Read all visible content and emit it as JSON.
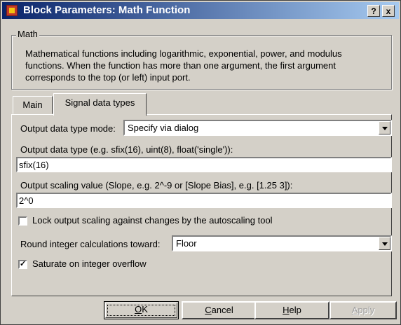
{
  "window": {
    "title": "Block Parameters: Math Function",
    "help_button": "?",
    "close_button": "x"
  },
  "math_group": {
    "label": "Math",
    "description": "Mathematical functions including logarithmic, exponential, power, and modulus functions.  When the function has more than one argument, the first argument corresponds to the top (or left) input port."
  },
  "tabs": [
    {
      "label": "Main",
      "selected": false
    },
    {
      "label": "Signal data types",
      "selected": true
    }
  ],
  "signal_data_types": {
    "output_mode_label": "Output data type mode:",
    "output_mode_value": "Specify via dialog",
    "output_type_label": "Output data type (e.g. sfix(16), uint(8), float('single')):",
    "output_type_value": "sfix(16)",
    "output_scaling_label": "Output scaling value (Slope, e.g. 2^-9 or [Slope Bias], e.g. [1.25 3]):",
    "output_scaling_value": "2^0",
    "lock_scaling_label": "Lock output scaling against changes by the autoscaling tool",
    "lock_scaling_checked": false,
    "round_label": "Round integer calculations toward:",
    "round_value": "Floor",
    "saturate_label": "Saturate on integer overflow",
    "saturate_checked": true
  },
  "buttons": {
    "ok": {
      "first": "O",
      "rest": "K"
    },
    "cancel": {
      "first": "C",
      "rest": "ancel"
    },
    "help": {
      "first": "H",
      "rest": "elp"
    },
    "apply": {
      "first": "A",
      "rest": "pply"
    }
  }
}
